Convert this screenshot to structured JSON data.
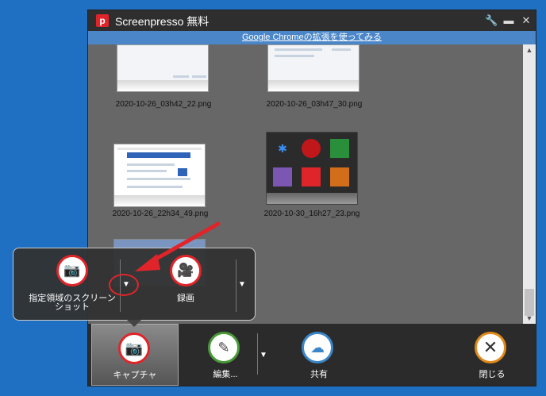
{
  "window": {
    "title": "Screenpresso 無料",
    "logo_letter": "p",
    "buttons": {
      "settings": "🔧",
      "minimize": "▬",
      "close": "✕"
    }
  },
  "banner": {
    "text": "Google Chromeの拡張を使ってみる"
  },
  "gallery": {
    "items": [
      {
        "filename": "2020-10-26_03h42_22.png"
      },
      {
        "filename": "2020-10-26_03h47_30.png"
      },
      {
        "filename": "2020-10-26_22h34_49.png"
      },
      {
        "filename": "2020-10-30_16h27_23.png"
      }
    ]
  },
  "capture_popup": {
    "region": {
      "label": "指定領域のスクリーンショット",
      "icon": "camera-icon"
    },
    "record": {
      "label": "録画",
      "icon": "video-camera-icon"
    }
  },
  "toolbar": {
    "capture": {
      "label": "キャプチャ",
      "icon": "camera-icon",
      "color": "#e0252a"
    },
    "edit": {
      "label": "編集...",
      "icon": "pencil-ruler-icon",
      "color": "#4a9a3a"
    },
    "share": {
      "label": "共有",
      "icon": "cloud-upload-icon",
      "color": "#3a86c8"
    },
    "close": {
      "label": "閉じる",
      "icon": "close-x-icon",
      "color": "#e08a1a"
    }
  },
  "colors": {
    "accent": "#e0252a",
    "banner": "#4a86c8"
  }
}
